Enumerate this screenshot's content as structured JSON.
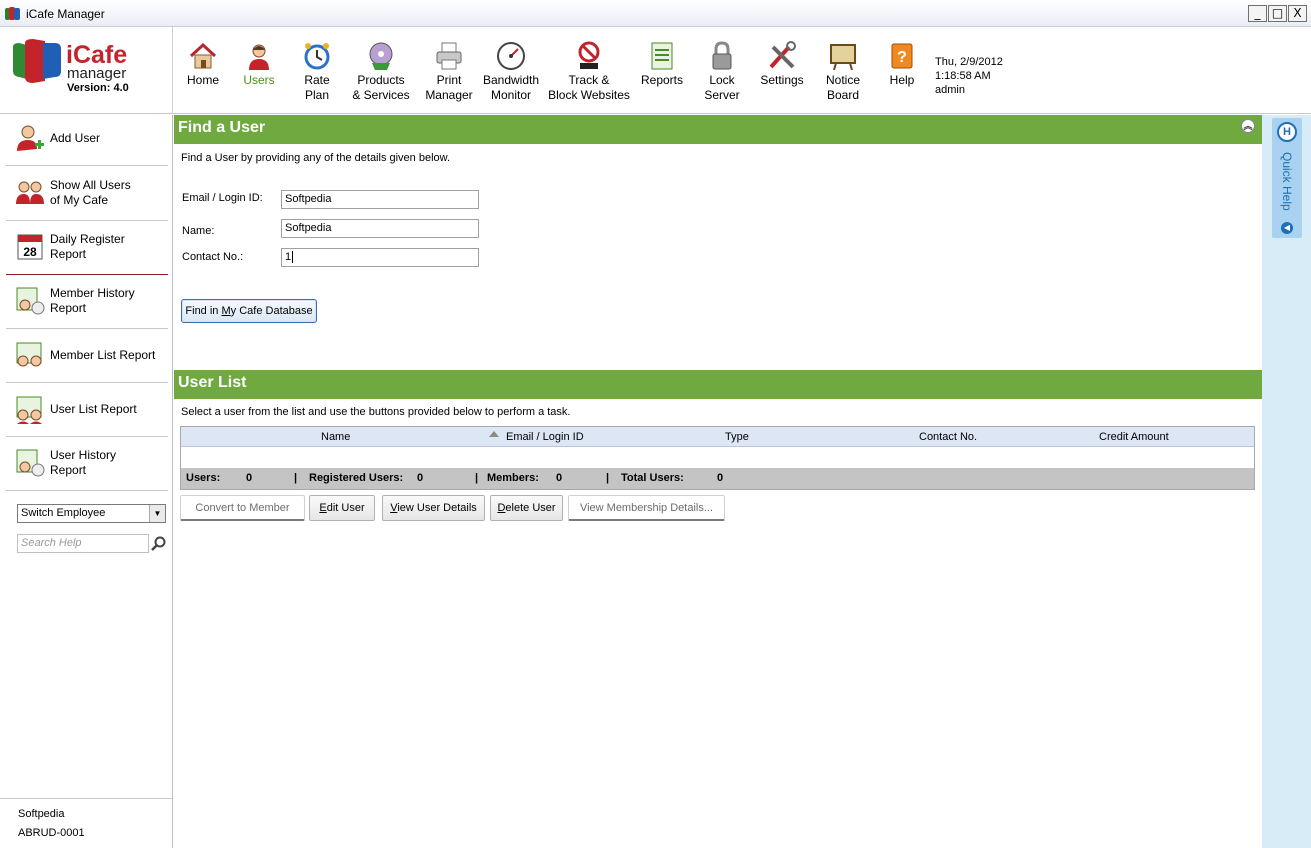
{
  "window": {
    "title": "iCafe Manager",
    "minimize": "_",
    "maximize": "□",
    "close": "X"
  },
  "logo": {
    "word1": "iCafe",
    "word2": "manager",
    "version": "Version: 4.0"
  },
  "nav": [
    {
      "line1": "Home",
      "line2": "",
      "icon": "home-icon"
    },
    {
      "line1": "Users",
      "line2": "",
      "icon": "users-icon"
    },
    {
      "line1": "Rate",
      "line2": "Plan",
      "icon": "rate-plan-icon"
    },
    {
      "line1": "Products",
      "line2": "& Services",
      "icon": "products-icon"
    },
    {
      "line1": "Print",
      "line2": "Manager",
      "icon": "printer-icon"
    },
    {
      "line1": "Bandwidth",
      "line2": "Monitor",
      "icon": "gauge-icon"
    },
    {
      "line1": "Track &",
      "line2": "Block Websites",
      "icon": "block-www-icon"
    },
    {
      "line1": "Reports",
      "line2": "",
      "icon": "reports-icon"
    },
    {
      "line1": "Lock",
      "line2": "Server",
      "icon": "lock-icon"
    },
    {
      "line1": "Settings",
      "line2": "",
      "icon": "settings-icon"
    },
    {
      "line1": "Notice",
      "line2": "Board",
      "icon": "notice-board-icon"
    },
    {
      "line1": "Help",
      "line2": "",
      "icon": "help-icon"
    }
  ],
  "status": {
    "date": "Thu, 2/9/2012",
    "time": "1:18:58 AM",
    "user": "admin"
  },
  "sidebar": {
    "items": [
      {
        "line1": "Add User",
        "line2": ""
      },
      {
        "line1": "Show All Users",
        "line2": "of My Cafe"
      },
      {
        "line1": "Daily Register",
        "line2": "Report",
        "calendar_day": "28"
      },
      {
        "line1": "Member History",
        "line2": "Report"
      },
      {
        "line1": "Member List Report",
        "line2": ""
      },
      {
        "line1": "User List Report",
        "line2": ""
      },
      {
        "line1": "User History",
        "line2": "Report"
      }
    ],
    "employee_select": "Switch Employee",
    "search_placeholder": "Search Help",
    "footer_name": "Softpedia",
    "footer_id": "ABRUD-0001"
  },
  "find": {
    "title": "Find a User",
    "hint": "Find a User by providing any of the details given below.",
    "email_label": "Email / Login ID:",
    "email_value": "Softpedia",
    "name_label": "Name:",
    "name_value": "Softpedia",
    "contact_label": "Contact No.:",
    "contact_value": "1",
    "button_pre": "Find in ",
    "button_u": "M",
    "button_post": "y Cafe Database"
  },
  "userlist": {
    "title": "User List",
    "hint": "Select a user from the list and use the buttons provided below to perform a task.",
    "columns": [
      "Name",
      "Email / Login ID",
      "Type",
      "Contact No.",
      "Credit Amount"
    ],
    "footer": {
      "users_label": "Users:",
      "users": "0",
      "registered_label": "Registered Users:",
      "registered": "0",
      "members_label": "Members:",
      "members": "0",
      "total_label": "Total Users:",
      "total": "0",
      "sep": "|"
    },
    "buttons": {
      "convert": "Convert to Member",
      "edit_u": "E",
      "edit_rest": "dit User",
      "view_u": "V",
      "view_rest": "iew User Details",
      "delete_u": "D",
      "delete_rest": "elete User",
      "membership": "View Membership Details..."
    }
  },
  "quickhelp": {
    "label": "Quick Help",
    "icon_letter": "H"
  },
  "colors": {
    "section_green": "#6fa940",
    "active_nav": "#4c8c1a",
    "brand_red": "#c3242b",
    "quickhelp_bg": "#d8ecf8"
  }
}
